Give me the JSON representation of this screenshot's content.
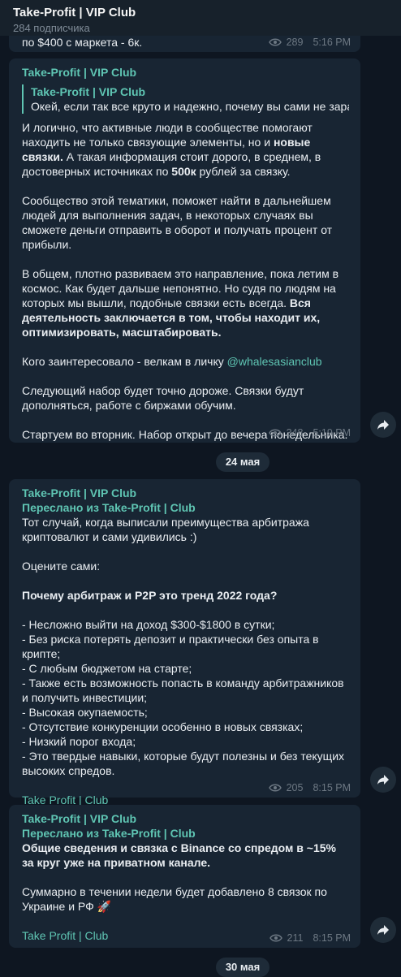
{
  "header": {
    "title": "Take-Profit | VIP Club",
    "subscribers": "284 подписчика"
  },
  "prev_message": {
    "text": "по $400 с маркета - 6к.",
    "views": "289",
    "time": "5:16 PM"
  },
  "messages": [
    {
      "channel": "Take-Profit | VIP Club",
      "reply": {
        "name": "Take-Profit | VIP Club",
        "text": "Окей, если так все круто и надежно, почему вы сами не зараб..."
      },
      "p1a": "И логично, что активные люди в сообществе помогают находить не только связующие элементы, но и ",
      "p1b": "новые связки.",
      "p1c": " А такая информация стоит дорого, в среднем, в достоверных источниках по ",
      "p1d": "500к",
      "p1e": " рублей за связку.",
      "p2": "Сообщество этой тематики, поможет найти в дальнейшем людей для выполнения задач, в некоторых случаях вы сможете деньги отправить в оборот и получать процент от прибыли.",
      "p3a": "В общем, плотно развиваем это направление, пока летим в космос. Как будет дальше непонятно. Но судя по людям на которых мы вышли, подобные связки есть всегда. ",
      "p3b": "Вся деятельность заключается в том, чтобы находит их, оптимизировать, масштабировать.",
      "p4a": "Кого заинтересовало - велкам в личку ",
      "p4link": "@whalesasianclub",
      "p5": "Следующий набор будет точно дороже. Связки будут дополняться, работе с биржами обучим.",
      "p6": "Стартуем во вторник. Набор открыт до вечера понедельника.",
      "views": "348",
      "time": "5:19 PM"
    },
    {
      "channel": "Take-Profit | VIP Club",
      "forwarded": "Переслано из Take-Profit | Club",
      "p1": "Тот случай, когда выписали преимущества арбитража криптовалют и сами удивились :)",
      "p2": "Оцените сами:",
      "p3": "Почему арбитраж и P2P это тренд 2022 года?",
      "items": [
        "- Несложно выйти на доход $300-$1800 в сутки;",
        "- Без риска потерять депозит и практически без опыта в крипте;",
        "- С любым бюджетом на старте;",
        "- Также есть возможность попасть в команду арбитражников и получить инвестиции;",
        "- Высокая окупаемость;",
        "- Отсутствие конкуренции особенно в новых связках;",
        "- Низкий порог входа;",
        "- Это твердые навыки, которые будут полезны и без текущих высоких спредов."
      ],
      "signature": "Take Profit | Club",
      "views": "205",
      "time": "8:15 PM"
    },
    {
      "channel": "Take-Profit | VIP Club",
      "forwarded": "Переслано из Take-Profit | Club",
      "p1": "Общие сведения и связка с Binance со спредом в ~15% за круг уже на приватном канале.",
      "p2": "Суммарно в течении недели будет добавлено 8 связок по Украине и РФ 🚀",
      "signature": "Take Profit | Club",
      "views": "211",
      "time": "8:15 PM"
    }
  ],
  "dates": {
    "d1": "24 мая",
    "d2": "30 мая"
  },
  "colors": {
    "background": "#0e1621",
    "bubble": "#182533",
    "accent": "#5fc5b3",
    "meta": "#6d7883"
  },
  "icons": {
    "views": "eye-icon",
    "share": "share-arrow-icon"
  }
}
